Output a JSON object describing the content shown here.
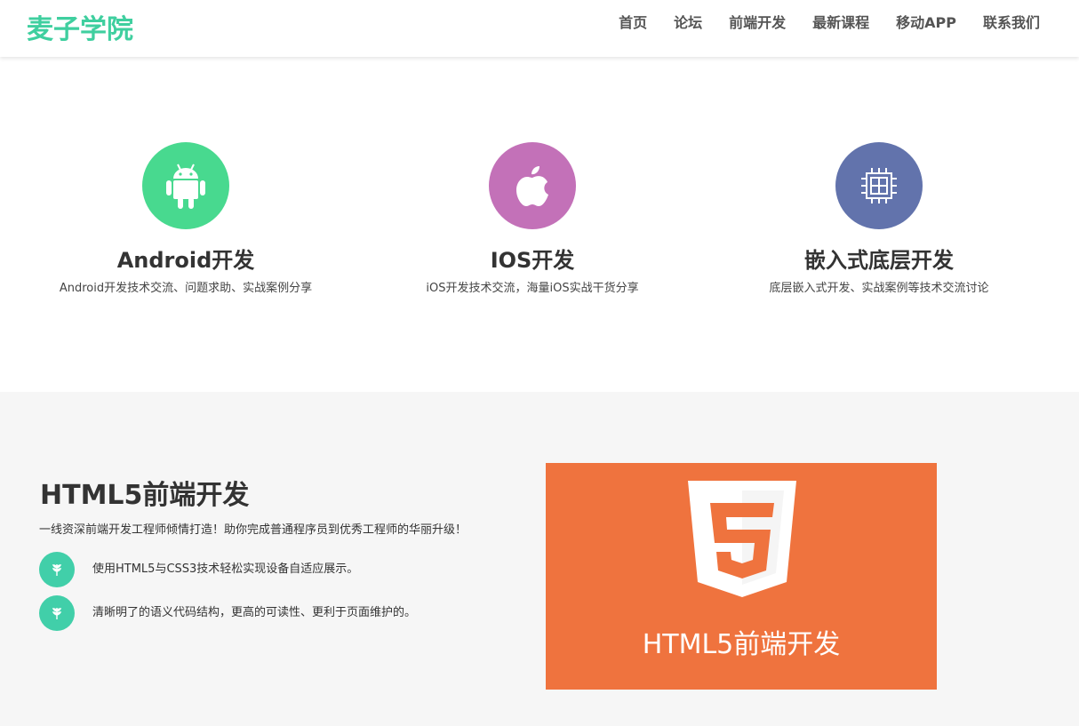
{
  "header": {
    "logo": "麦子学院",
    "nav": [
      "首页",
      "论坛",
      "前端开发",
      "最新课程",
      "移动APP",
      "联系我们"
    ]
  },
  "features": [
    {
      "icon": "android-icon",
      "color": "#48d98f",
      "title": "Android开发",
      "desc": "Android开发技术交流、问题求助、实战案例分享"
    },
    {
      "icon": "apple-icon",
      "color": "#c371b8",
      "title": "IOS开发",
      "desc": "iOS开发技术交流，海量iOS实战干货分享"
    },
    {
      "icon": "chip-icon",
      "color": "#6273ac",
      "title": "嵌入式底层开发",
      "desc": "底层嵌入式开发、实战案例等技术交流讨论"
    }
  ],
  "html5": {
    "title": "HTML5前端开发",
    "desc": "一线资深前端开发工程师倾情打造！助你完成普通程序员到优秀工程师的华丽升级！",
    "points": [
      "使用HTML5与CSS3技术轻松实现设备自适应展示。",
      "清晰明了的语义代码结构，更高的可读性、更利于页面维护的。"
    ],
    "banner_title": "HTML5前端开发",
    "banner_color": "#ef733e",
    "accent_color": "#41cfa9"
  }
}
